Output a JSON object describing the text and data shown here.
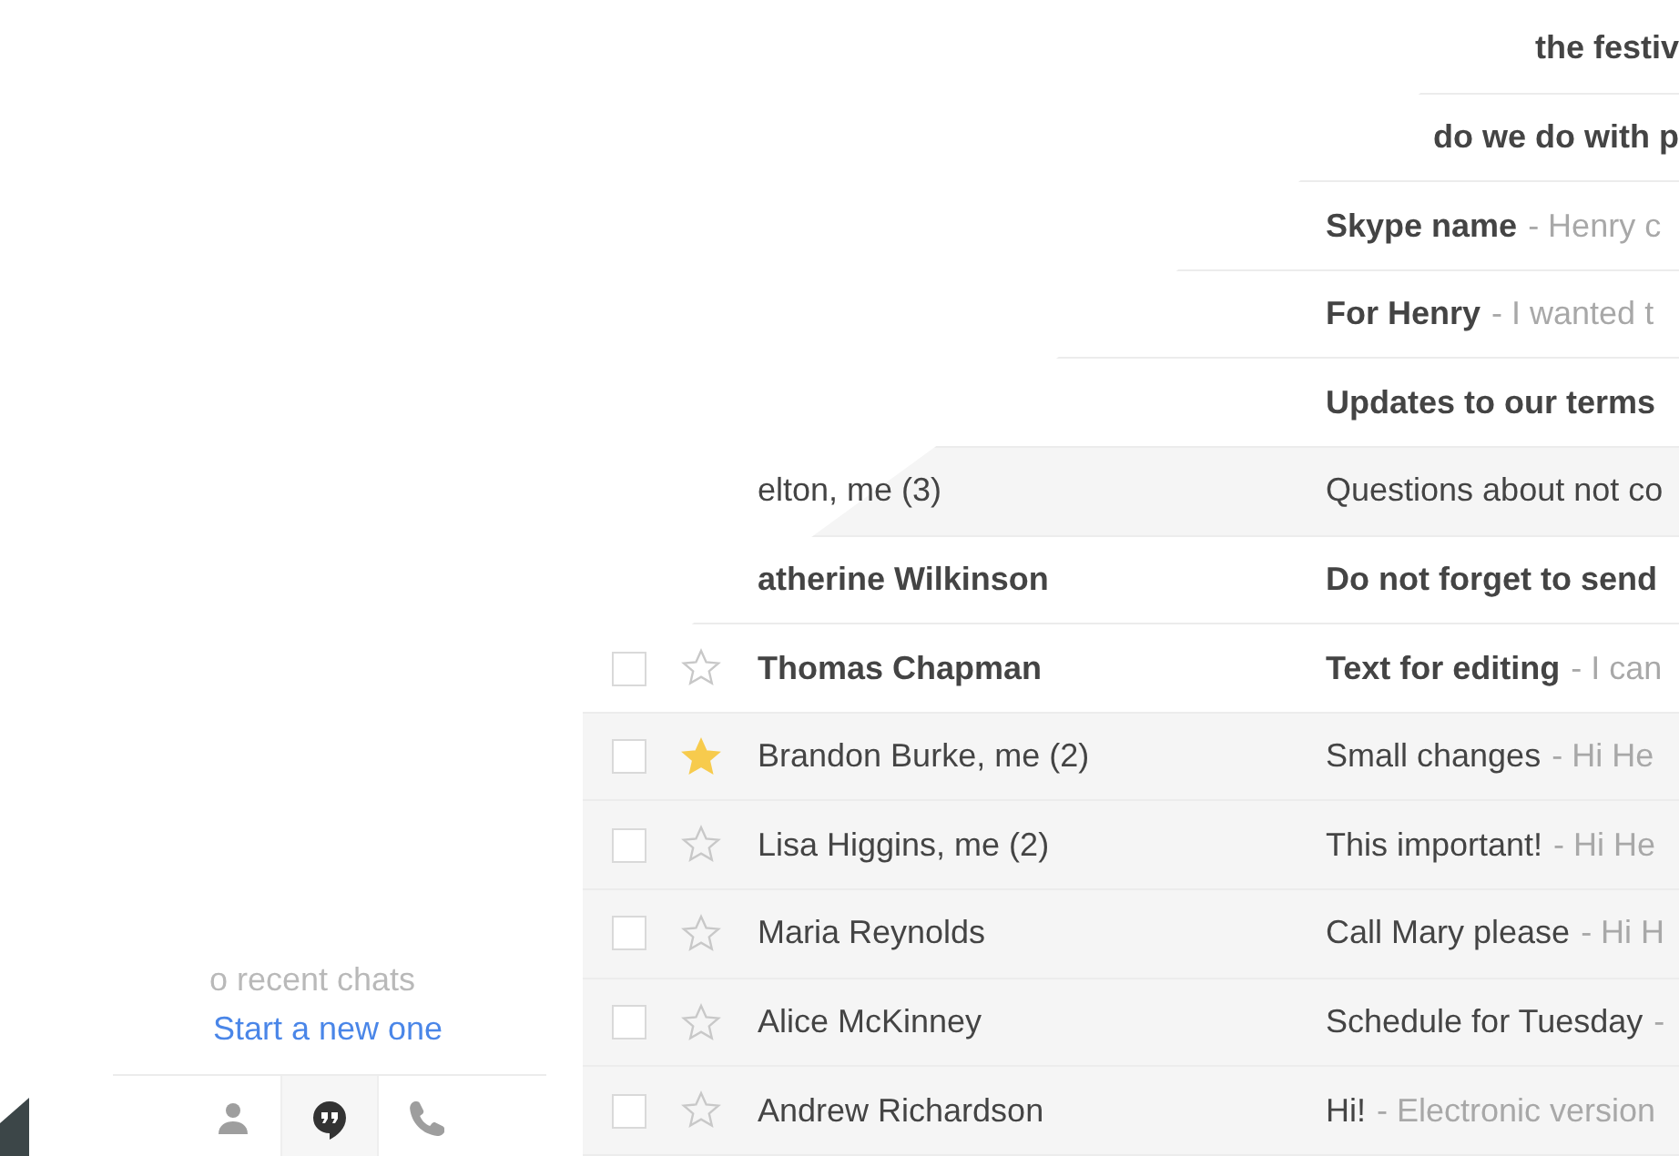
{
  "chat": {
    "empty_text": "o recent chats",
    "start_link": "Start a new one",
    "tabs": [
      {
        "kind": "contacts",
        "selected": false
      },
      {
        "kind": "hangouts",
        "selected": true
      },
      {
        "kind": "phone",
        "selected": false
      }
    ]
  },
  "messages": [
    {
      "kind": "cut",
      "subject": "the festiv",
      "unread": true
    },
    {
      "kind": "cut",
      "subject": "do we do with p",
      "unread": true
    },
    {
      "kind": "full",
      "subject": "Skype name",
      "snippet": "- Henry c",
      "unread": true
    },
    {
      "kind": "full",
      "subject": "For Henry",
      "snippet": "- I wanted t",
      "unread": true
    },
    {
      "kind": "full",
      "subject": "Updates to our terms",
      "unread": true
    },
    {
      "kind": "full",
      "sender": "elton, me (3)",
      "subject": "Questions about not co",
      "unread": false
    },
    {
      "kind": "full",
      "sender": "atherine Wilkinson",
      "subject": "Do not forget to send",
      "unread": true
    },
    {
      "kind": "full",
      "sender": "Thomas Chapman",
      "subject": "Text for editing",
      "snippet": "- I can",
      "unread": true,
      "checked": false,
      "starred": false
    },
    {
      "kind": "full",
      "sender": "Brandon Burke, me (2)",
      "subject": "Small changes",
      "snippet": "- Hi He",
      "unread": false,
      "checked": false,
      "starred": true
    },
    {
      "kind": "full",
      "sender": "Lisa Higgins, me (2)",
      "subject": "This important!",
      "snippet": "- Hi He",
      "unread": false,
      "checked": false,
      "starred": false
    },
    {
      "kind": "full",
      "sender": "Maria Reynolds",
      "subject": "Call Mary please",
      "snippet": "- Hi H",
      "unread": false,
      "checked": false,
      "starred": false
    },
    {
      "kind": "full",
      "sender": "Alice McKinney",
      "subject": "Schedule for Tuesday",
      "snippet": "-",
      "unread": false,
      "checked": false,
      "starred": false
    },
    {
      "kind": "full",
      "sender": "Andrew Richardson",
      "subject": "Hi!",
      "snippet": "- Electronic version",
      "unread": false,
      "checked": false,
      "starred": false
    }
  ]
}
